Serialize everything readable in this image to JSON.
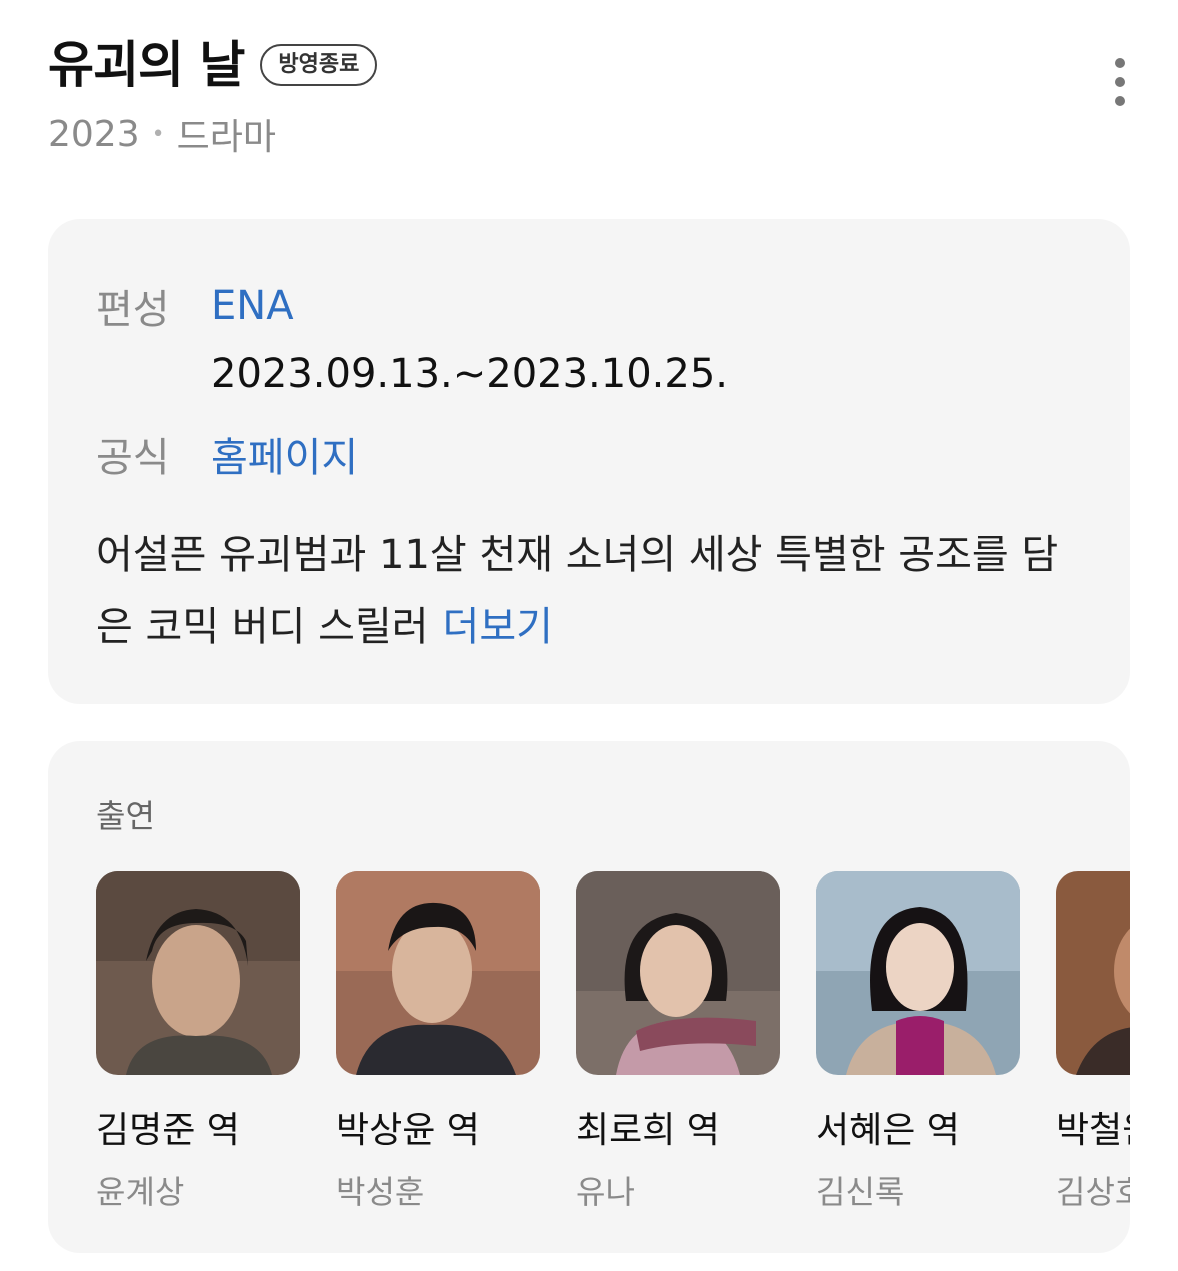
{
  "header": {
    "title": "유괴의 날",
    "badge": "방영종료",
    "year": "2023",
    "separator": "•",
    "genre": "드라마"
  },
  "info": {
    "broadcast_label": "편성",
    "broadcast_value": "ENA",
    "period": "2023.09.13.~2023.10.25.",
    "official_label": "공식",
    "official_value": "홈페이지",
    "description": "어설픈 유괴범과 11살 천재 소녀의 세상 특별한 공조를 담은 코믹 버디 스릴러",
    "more_label": "더보기"
  },
  "cast": {
    "title": "출연",
    "items": [
      {
        "role": "김명준 역",
        "actor": "윤계상"
      },
      {
        "role": "박상윤 역",
        "actor": "박성훈"
      },
      {
        "role": "최로희 역",
        "actor": "유나"
      },
      {
        "role": "서혜은 역",
        "actor": "김신록"
      },
      {
        "role": "박철원 역",
        "actor": "김상호"
      }
    ]
  },
  "colors": {
    "link": "#2f6fc2",
    "card_bg": "#f5f5f5",
    "muted": "#8a8a8a"
  },
  "icons": {
    "more": "more-vertical-icon"
  }
}
